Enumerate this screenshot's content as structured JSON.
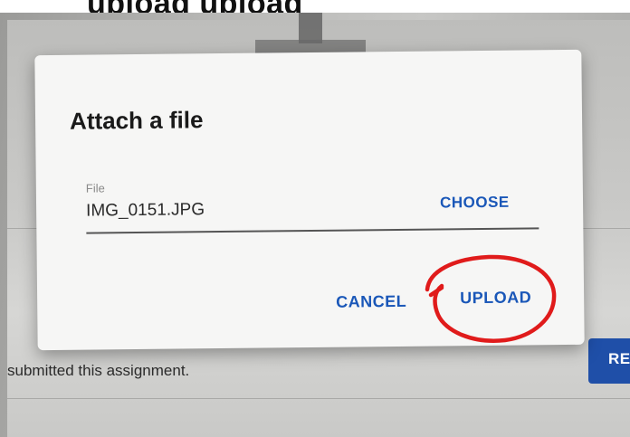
{
  "caption": {
    "text": "upload upload"
  },
  "dialog": {
    "title": "Attach a file",
    "file_field": {
      "label": "File",
      "value": "IMG_0151.JPG",
      "choose_label": "CHOOSE"
    },
    "actions": {
      "cancel_label": "CANCEL",
      "upload_label": "UPLOAD"
    }
  },
  "background": {
    "status_text": "submitted this assignment.",
    "button_label": "RE"
  },
  "annotation": {
    "shape": "hand-drawn circle around upload button",
    "color": "#e01b1b"
  },
  "colors": {
    "accent": "#1a57b8",
    "dialog_bg": "#f6f6f5"
  }
}
